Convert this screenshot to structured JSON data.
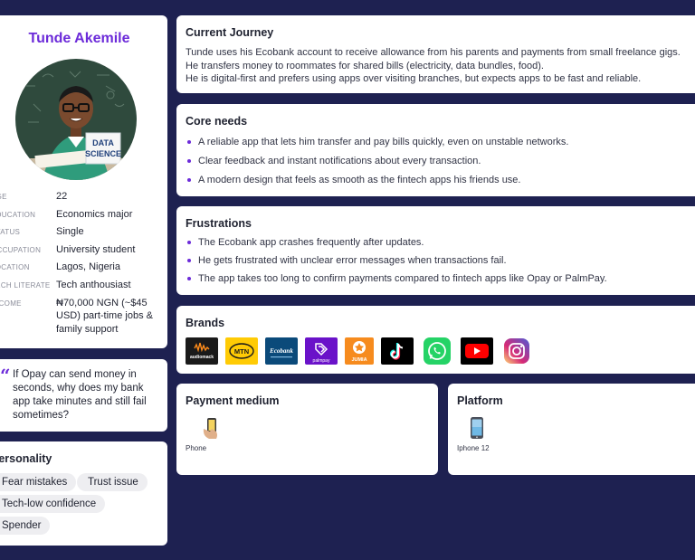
{
  "profile": {
    "name": "Tunde Akemile",
    "photo_badge": {
      "line1": "DATA",
      "line2": "SCIENCE"
    },
    "attributes": [
      {
        "key": "AGE",
        "value": "22"
      },
      {
        "key": "EDUCATION",
        "value": "Economics major"
      },
      {
        "key": "STATUS",
        "value": "Single"
      },
      {
        "key": "OCCUPATION",
        "value": "University student"
      },
      {
        "key": "LOCATION",
        "value": "Lagos, Nigeria"
      },
      {
        "key": "TECH LITERATE",
        "value": "Tech anthousiast"
      },
      {
        "key": "INCOME",
        "value": "₦70,000 NGN (~$45 USD) part-time jobs & family support"
      }
    ]
  },
  "quote": {
    "mark": "“",
    "text": "If Opay can send money in seconds, why does my bank app take minutes and still fail sometimes?"
  },
  "personality": {
    "title": "Personality",
    "tags": [
      "Fear mistakes",
      "Trust issue",
      "Tech-low confidence",
      "Spender"
    ]
  },
  "journey": {
    "title": "Current Journey",
    "lines": [
      "Tunde uses his Ecobank account to receive allowance from his parents and payments from small freelance gigs.",
      "He transfers money to roommates for shared bills (electricity, data bundles, food).",
      "He is digital-first and prefers using apps over visiting branches, but expects apps to be fast and reliable."
    ]
  },
  "needs": {
    "title": "Core needs",
    "items": [
      "A reliable app that lets him transfer and pay bills quickly, even on unstable networks.",
      "Clear feedback and instant notifications about every transaction.",
      "A modern design that feels as smooth as the fintech apps his friends use."
    ]
  },
  "frustrations": {
    "title": "Frustrations",
    "items": [
      "The Ecobank app crashes frequently after updates.",
      "He gets frustrated with unclear error messages when transactions fail.",
      "The app takes too long to confirm payments compared to fintech apps like Opay or PalmPay."
    ]
  },
  "brands": {
    "title": "Brands",
    "logos": [
      {
        "icon": "audiomack-logo",
        "text": "audiomack",
        "bg": "#1a1a1a",
        "fg": "#ff8c1a"
      },
      {
        "icon": "mtn-logo",
        "text": "MTN",
        "bg": "#ffcb05",
        "fg": "#1a1a1a"
      },
      {
        "icon": "ecobank-logo",
        "text": "Ecobank",
        "bg": "#0b4a7a",
        "fg": "#ffffff"
      },
      {
        "icon": "palmpay-logo",
        "text": "palmpay",
        "bg": "#6a12c9",
        "fg": "#ffffff"
      },
      {
        "icon": "jumia-logo",
        "text": "JUMIA",
        "bg": "#f68b1e",
        "fg": "#ffffff"
      },
      {
        "icon": "tiktok-logo",
        "text": "",
        "bg": "#000000",
        "fg": "#ffffff"
      },
      {
        "icon": "whatsapp-logo",
        "text": "",
        "bg": "#ffffff",
        "fg": "#25d366"
      },
      {
        "icon": "youtube-logo",
        "text": "",
        "bg": "#000000",
        "fg": "#ff0000"
      },
      {
        "icon": "instagram-logo",
        "text": "",
        "bg": "#ffffff",
        "fg": "#d62976"
      }
    ]
  },
  "payment": {
    "title": "Payment medium",
    "item_label": "Phone",
    "item_icon": "hand-phone-icon"
  },
  "platform": {
    "title": "Platform",
    "item_label": "Iphone 12",
    "item_icon": "smartphone-icon"
  }
}
